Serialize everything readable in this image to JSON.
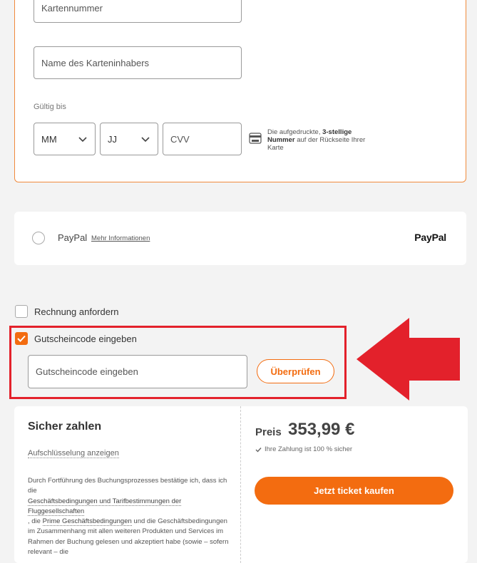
{
  "card": {
    "number_placeholder": "Kartennummer",
    "holder_placeholder": "Name des Karteninhabers",
    "valid_label": "Gültig bis",
    "month_value": "MM",
    "year_value": "JJ",
    "cvv_placeholder": "CVV",
    "cvv_hint_pre": "Die aufgedruckte,",
    "cvv_hint_bold": "3-stellige Nummer",
    "cvv_hint_post": "auf der Rückseite Ihrer Karte"
  },
  "paypal": {
    "name": "PayPal",
    "info_link": "Mehr Informationen",
    "logo": "PayPal"
  },
  "options": {
    "invoice_label": "Rechnung anfordern",
    "voucher_label": "Gutscheincode eingeben",
    "voucher_placeholder": "Gutscheincode eingeben",
    "check_button": "Überprüfen"
  },
  "summary": {
    "title": "Sicher zahlen",
    "breakdown_link": "Aufschlüsselung anzeigen",
    "legal_1": "Durch Fortführung des Buchungsprozesses bestätige ich, dass ich die",
    "legal_link_1": "Geschäftsbedingungen und Tarifbestimmungen der Fluggesellschaften",
    "legal_2": ", die",
    "legal_link_2": "Prime Geschäftsbedingungen",
    "legal_3": "und die Geschäftsbedingungen im Zusammenhang mit allen weiteren Produkten und Services im Rahmen der Buchung gelesen und akzeptiert habe (sowie – sofern relevant – die",
    "price_label": "Preis",
    "price_value": "353,99 €",
    "secure_text": "Ihre Zahlung ist 100 % sicher",
    "buy_button": "Jetzt ticket kaufen"
  },
  "colors": {
    "accent": "#f36c10",
    "highlight": "#e3212b"
  }
}
